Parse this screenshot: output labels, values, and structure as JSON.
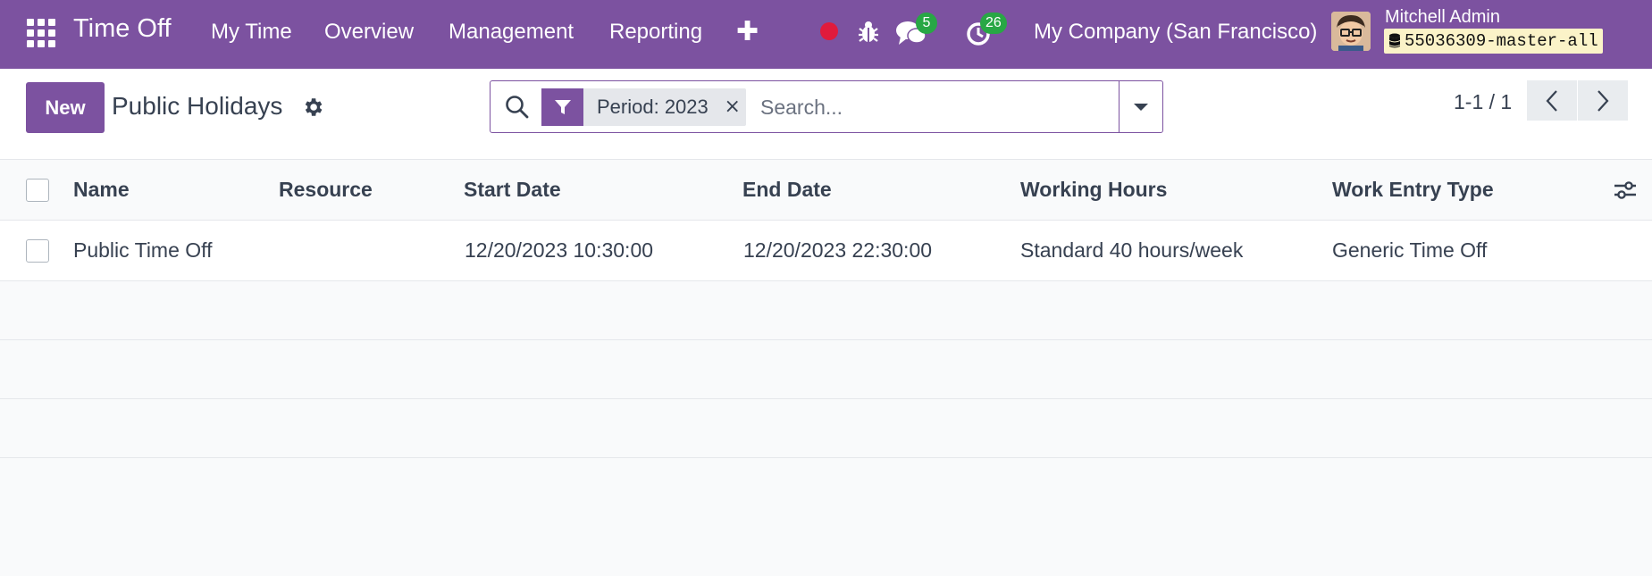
{
  "navbar": {
    "app_title": "Time Off",
    "menu": [
      "My Time",
      "Overview",
      "Management",
      "Reporting"
    ],
    "messages_count": "5",
    "activities_count": "26",
    "company": "My Company (San Francisco)",
    "user_name": "Mitchell Admin",
    "database": "55036309-master-all",
    "colors": {
      "brand": "#7c52a0",
      "record": "#e01b3c",
      "badge": "#28a745"
    }
  },
  "control": {
    "new_label": "New",
    "page_title": "Public Holidays",
    "facet_label": "Period: 2023",
    "facet_close": "×",
    "search_placeholder": "Search...",
    "pager": "1-1 / 1"
  },
  "table": {
    "columns": [
      "Name",
      "Resource",
      "Start Date",
      "End Date",
      "Working Hours",
      "Work Entry Type"
    ],
    "rows": [
      {
        "name": "Public Time Off",
        "resource": "",
        "start_date": "12/20/2023 10:30:00",
        "end_date": "12/20/2023 22:30:00",
        "working_hours": "Standard 40 hours/week",
        "work_entry_type": "Generic Time Off"
      }
    ]
  }
}
